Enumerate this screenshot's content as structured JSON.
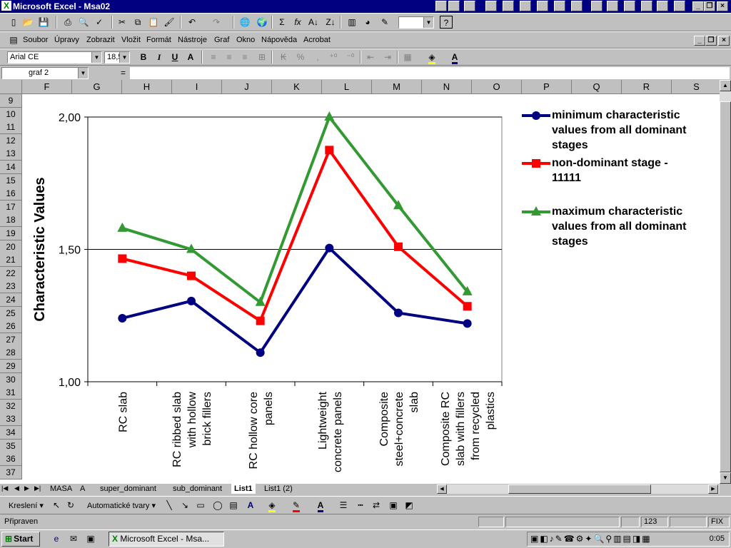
{
  "window": {
    "title": "Microsoft Excel - Msa02"
  },
  "menu": {
    "items": [
      "Soubor",
      "Úpravy",
      "Zobrazit",
      "Vložit",
      "Formát",
      "Nástroje",
      "Graf",
      "Okno",
      "Nápověda",
      "Acrobat"
    ]
  },
  "format_toolbar": {
    "font_name": "Arial CE",
    "font_size": "18,5"
  },
  "formula_bar": {
    "name_box": "graf 2",
    "equals": "="
  },
  "columns": [
    "F",
    "G",
    "H",
    "I",
    "J",
    "K",
    "L",
    "M",
    "N",
    "O",
    "P",
    "Q",
    "R",
    "S"
  ],
  "rows": [
    "9",
    "10",
    "11",
    "12",
    "13",
    "14",
    "15",
    "16",
    "17",
    "18",
    "19",
    "20",
    "21",
    "22",
    "23",
    "24",
    "25",
    "26",
    "27",
    "28",
    "29",
    "30",
    "31",
    "32",
    "33",
    "34",
    "35",
    "36",
    "37"
  ],
  "chart_data": {
    "type": "line",
    "categories": [
      "RC slab",
      "RC ribbed slab with hollow brick fillers",
      "RC hollow core panels",
      "Lightweight concrete panels",
      "Composite steel+concrete slab",
      "Composite RC slab with fillers from recycled plastics"
    ],
    "category_lines": [
      [
        "RC slab"
      ],
      [
        "RC ribbed slab",
        "with hollow",
        "brick fillers"
      ],
      [
        "RC hollow core",
        "panels"
      ],
      [
        "Lightweight",
        "concrete panels"
      ],
      [
        "Composite",
        "steel+concrete",
        "slab"
      ],
      [
        "Composite RC",
        "slab with fillers",
        "from recycled",
        "plastics"
      ]
    ],
    "ylabel": "Characteristic Values",
    "ylim": [
      1.0,
      2.0
    ],
    "yticks": [
      "1,00",
      "1,50",
      "2,00"
    ],
    "ytick_values": [
      1.0,
      1.5,
      2.0
    ],
    "gridlines_y": [
      1.5,
      2.0
    ],
    "legend_position": "right",
    "series": [
      {
        "name": "minimum characteristic values from all dominant stages",
        "legend_lines": [
          "minimum characteristic",
          "values from all dominant",
          "stages"
        ],
        "color": "#000080",
        "marker": "circle",
        "values": [
          1.24,
          1.305,
          1.11,
          1.505,
          1.26,
          1.22
        ]
      },
      {
        "name": "non-dominant stage - 11111",
        "legend_lines": [
          "non-dominant stage -",
          "11111"
        ],
        "color": "#ff0000",
        "marker": "square",
        "values": [
          1.465,
          1.4,
          1.23,
          1.875,
          1.51,
          1.285
        ]
      },
      {
        "name": "maximum characteristic values from all dominant stages",
        "legend_lines": [
          "maximum characteristic",
          "values from all dominant",
          "stages"
        ],
        "color": "#339933",
        "marker": "triangle",
        "values": [
          1.58,
          1.5,
          1.3,
          2.0,
          1.665,
          1.34
        ]
      }
    ]
  },
  "sheet_tabs": [
    "MASA",
    "A",
    "super_dominant",
    "sub_dominant",
    "List1",
    "List1 (2)"
  ],
  "active_tab": "List1",
  "drawing_toolbar": {
    "draw_label": "Kreslení",
    "autoshapes_label": "Automatické tvary"
  },
  "status": {
    "text": "Připraven",
    "num_indicator": "123",
    "fix_indicator": "FIX"
  },
  "taskbar": {
    "start_label": "Start",
    "task_label": "Microsoft Excel - Msa...",
    "clock": "0:05"
  }
}
